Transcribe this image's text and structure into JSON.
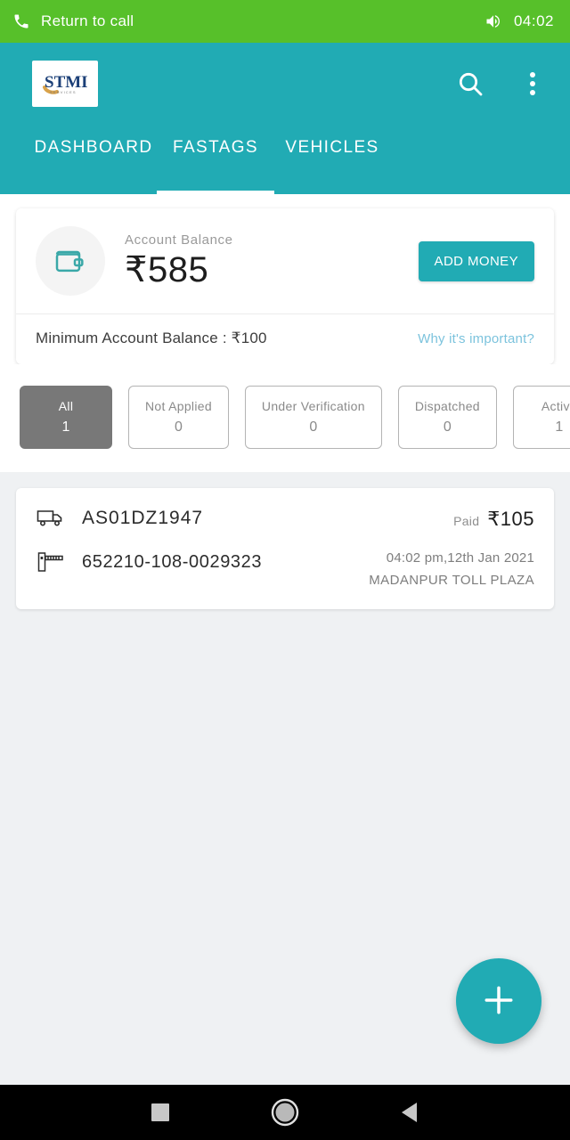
{
  "statusbar": {
    "phone_icon": "phone-icon",
    "return_label": "Return to call",
    "speaker_icon": "speaker-icon",
    "time": "04:02"
  },
  "appbar": {
    "logo_text": "STMI",
    "logo_alt": "stmi-logo",
    "search_icon": "search-icon",
    "overflow_icon": "overflow-menu-icon",
    "tabs": [
      {
        "label": "DASHBOARD",
        "active": false
      },
      {
        "label": "FASTAGS",
        "active": true
      },
      {
        "label": "VEHICLES",
        "active": false
      }
    ],
    "accent_color": "#21abb4"
  },
  "balance_card": {
    "wallet_icon": "wallet-icon",
    "label": "Account Balance",
    "amount": "₹585",
    "add_money_label": "ADD MONEY",
    "minimum_label": "Minimum Account Balance : ₹100",
    "why_link": "Why it's important?",
    "link_color": "#7cc3dd"
  },
  "filters": [
    {
      "label": "All",
      "count": "1",
      "selected": true
    },
    {
      "label": "Not Applied",
      "count": "0",
      "selected": false
    },
    {
      "label": "Under Verification",
      "count": "0",
      "selected": false
    },
    {
      "label": "Dispatched",
      "count": "0",
      "selected": false
    },
    {
      "label": "Active",
      "count": "1",
      "selected": false
    }
  ],
  "transactions": [
    {
      "vehicle_icon": "truck-icon",
      "vehicle_number": "AS01DZ1947",
      "tag_icon": "toll-barrier-icon",
      "tag_number": "652210-108-0029323",
      "paid_label": "Paid",
      "amount": "₹105",
      "datetime": "04:02 pm,12th Jan 2021",
      "plaza": "MADANPUR TOLL PLAZA"
    }
  ],
  "fab": {
    "icon": "plus-icon",
    "color": "#21abb4"
  },
  "navbar": {
    "recents_icon": "square-recents-icon",
    "home_icon": "circle-home-icon",
    "back_icon": "triangle-back-icon"
  },
  "colors": {
    "call_green": "#57c02a",
    "header_teal": "#21abb4",
    "page_background": "#eff1f3",
    "chip_selected": "#787878"
  }
}
